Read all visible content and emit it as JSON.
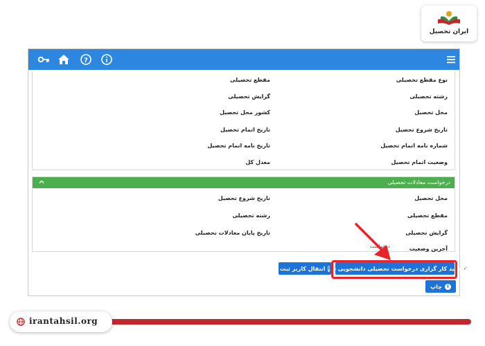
{
  "logo": {
    "text": "ایران تحصیل"
  },
  "navbar": {
    "icons": [
      "menu-icon",
      "info-icon",
      "help-icon",
      "home-icon",
      "key-icon"
    ],
    "color": "#2d86e0"
  },
  "education_details": {
    "rows": [
      {
        "label": "نوع مقطع تحصیلی",
        "label2": "مقطع تحصیلی"
      },
      {
        "label": "رشته تحصیلی",
        "label2": "گرایش تحصیلی"
      },
      {
        "label": "محل تحصیل",
        "label2": "کشور محل تحصیل"
      },
      {
        "label": "تاریخ شروع تحصیل",
        "label2": "تاریخ اتمام تحصیل"
      },
      {
        "label": "شماره نامه اتمام تحصیل",
        "label2": "تاریخ نامه اتمام تحصیل"
      },
      {
        "label": "وضعیت اتمام تحصیل",
        "label2": "معدل کل"
      }
    ]
  },
  "equivalence_panel": {
    "title": "درخواست معادلات تحصیلی",
    "color": "#4cae4c",
    "rows": [
      {
        "label": "محل تحصیل",
        "label2": "تاریخ شروع تحصیل"
      },
      {
        "label": "مقطع تحصیلی",
        "label2": "رشته تحصیلی"
      },
      {
        "label": "گرایش تحصیلی",
        "label2": "تاریخ پایان معادلات تحصیلی"
      },
      {
        "label": "آخرین وضعیت",
        "value": "درخواست"
      }
    ]
  },
  "buttons": {
    "confirm": "تایید کار گزاری درخواست تحصیلی دانشجویی داخل",
    "transfer": "انتقال کاربر ثبت",
    "print": "چاپ"
  },
  "annotation": {
    "highlight_color": "#e8242a"
  },
  "footer": {
    "website": "irantahsil.org",
    "accent": "#c1272d"
  }
}
